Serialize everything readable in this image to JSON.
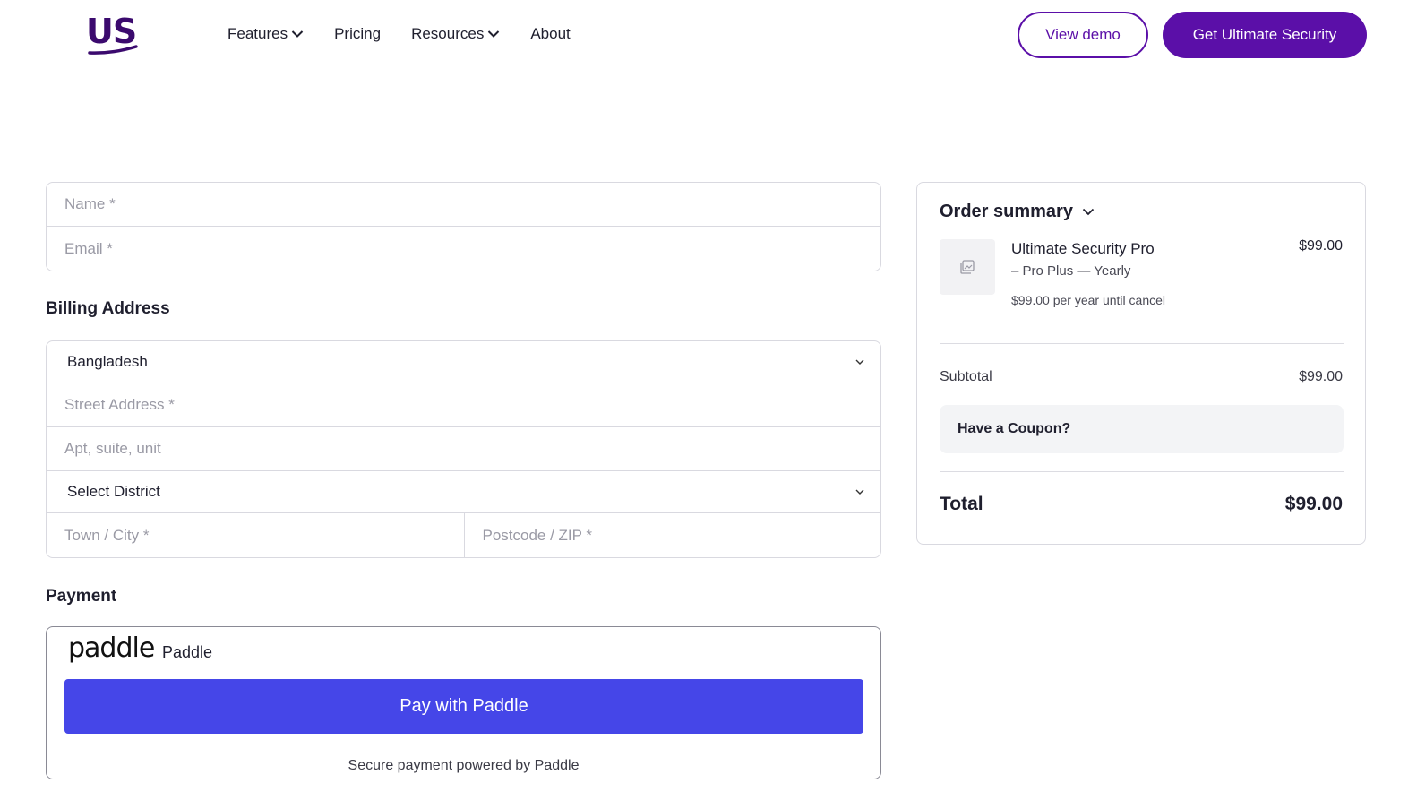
{
  "header": {
    "logo_text": "US",
    "nav": [
      {
        "label": "Features",
        "has_dropdown": true
      },
      {
        "label": "Pricing",
        "has_dropdown": false
      },
      {
        "label": "Resources",
        "has_dropdown": true
      },
      {
        "label": "About",
        "has_dropdown": false
      }
    ],
    "view_demo_label": "View demo",
    "get_label": "Get Ultimate Security",
    "brand_color": "#5b0fa8"
  },
  "contact": {
    "name_placeholder": "Name *",
    "email_placeholder": "Email *"
  },
  "billing": {
    "title": "Billing Address",
    "country_value": "Bangladesh",
    "street_placeholder": "Street Address *",
    "apt_placeholder": "Apt, suite, unit",
    "district_value": "Select District",
    "city_placeholder": "Town / City *",
    "postcode_placeholder": "Postcode / ZIP *"
  },
  "payment": {
    "title": "Payment",
    "provider_logo": "paddle",
    "provider_name": "Paddle",
    "pay_label": "Pay with Paddle",
    "secure_text": "Secure payment powered by Paddle",
    "pay_color": "#4546e8"
  },
  "summary": {
    "title": "Order summary",
    "product_name": "Ultimate Security Pro",
    "product_variant": "– Pro Plus — Yearly",
    "product_recur": "$99.00 per year until cancel",
    "product_price": "$99.00",
    "subtotal_label": "Subtotal",
    "subtotal_value": "$99.00",
    "coupon_label": "Have a Coupon?",
    "total_label": "Total",
    "total_value": "$99.00"
  }
}
